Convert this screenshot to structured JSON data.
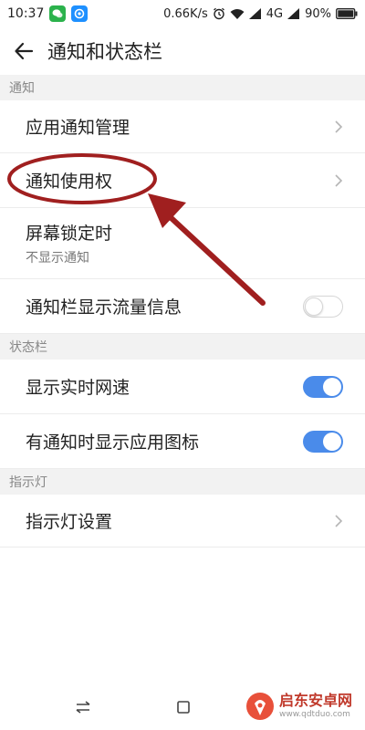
{
  "status_bar": {
    "time": "10:37",
    "speed": "0.66K/s",
    "network": "4G",
    "battery": "90%"
  },
  "header": {
    "title": "通知和状态栏"
  },
  "sections": {
    "notifications": "通知",
    "status_bar": "状态栏",
    "indicator": "指示灯"
  },
  "rows": {
    "app_notification_manage": "应用通知管理",
    "notification_access": "通知使用权",
    "lock_screen": "屏幕锁定时",
    "lock_screen_sub": "不显示通知",
    "show_traffic": "通知栏显示流量信息",
    "show_speed": "显示实时网速",
    "show_app_icon": "有通知时显示应用图标",
    "indicator_settings": "指示灯设置"
  },
  "toggles": {
    "show_traffic": false,
    "show_speed": true,
    "show_app_icon": true
  },
  "watermark": {
    "name": "启东安卓网",
    "url": "www.qdtduo.com"
  },
  "colors": {
    "accent": "#4a8bea",
    "annotation": "#a01f1f",
    "section_bg": "#f2f2f2"
  },
  "icons": [
    "back-arrow-icon",
    "chevron-right-icon",
    "alarm-icon",
    "wifi-icon",
    "signal-icon",
    "battery-icon",
    "back-nav-icon",
    "recents-icon"
  ]
}
